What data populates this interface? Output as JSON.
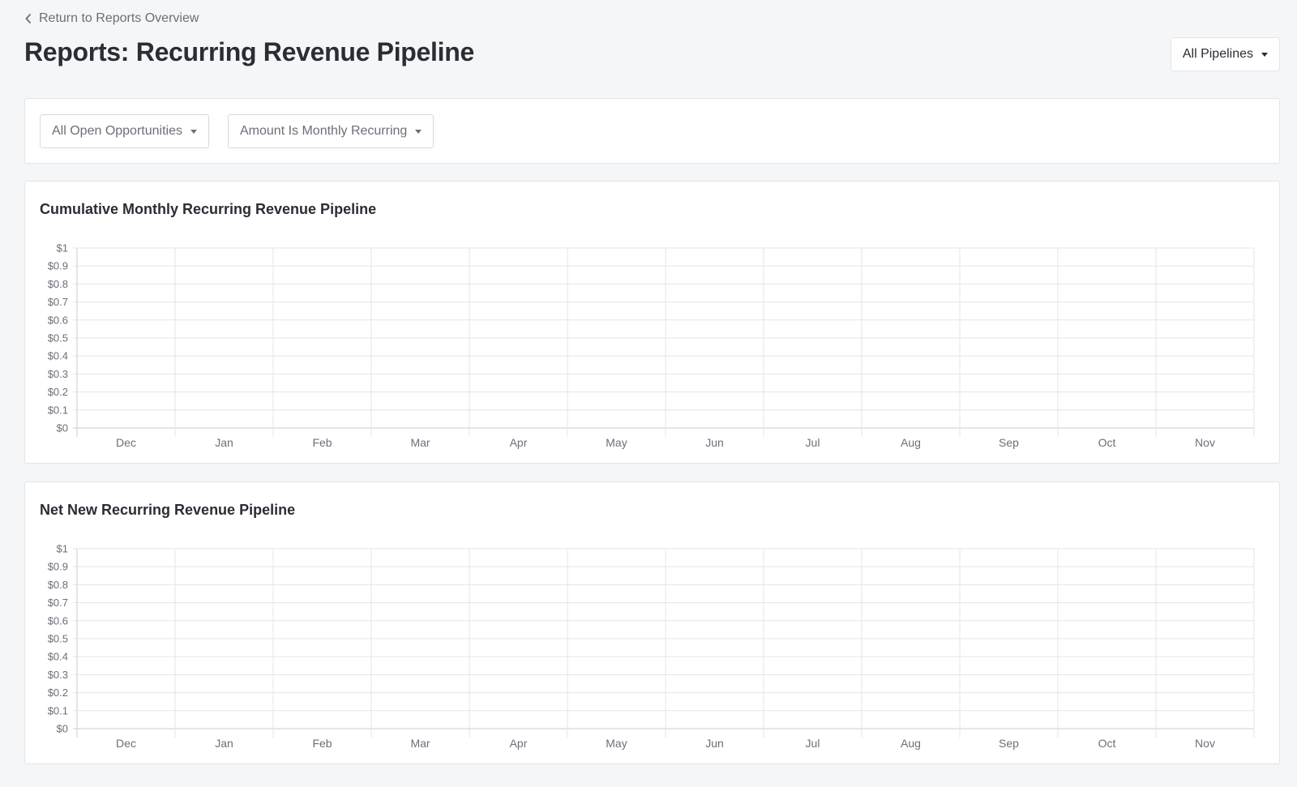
{
  "nav": {
    "back_label": "Return to Reports Overview"
  },
  "header": {
    "title": "Reports: Recurring Revenue Pipeline",
    "pipeline_select": "All Pipelines"
  },
  "filters": {
    "opportunities": "All Open Opportunities",
    "amount_type": "Amount Is Monthly Recurring"
  },
  "colors": {
    "background": "#f5f6f8",
    "grid": "#e3e5e8",
    "axis": "#c9ccd1",
    "text_muted": "#6b6f78"
  },
  "chart_data": [
    {
      "type": "line",
      "title": "Cumulative Monthly Recurring Revenue Pipeline",
      "categories": [
        "Dec",
        "Jan",
        "Feb",
        "Mar",
        "Apr",
        "May",
        "Jun",
        "Jul",
        "Aug",
        "Sep",
        "Oct",
        "Nov"
      ],
      "y_ticks": [
        "$0",
        "$0.1",
        "$0.2",
        "$0.3",
        "$0.4",
        "$0.5",
        "$0.6",
        "$0.7",
        "$0.8",
        "$0.9",
        "$1"
      ],
      "ylim": [
        0,
        1
      ],
      "series": [],
      "grid": true
    },
    {
      "type": "line",
      "title": "Net New Recurring Revenue Pipeline",
      "categories": [
        "Dec",
        "Jan",
        "Feb",
        "Mar",
        "Apr",
        "May",
        "Jun",
        "Jul",
        "Aug",
        "Sep",
        "Oct",
        "Nov"
      ],
      "y_ticks": [
        "$0",
        "$0.1",
        "$0.2",
        "$0.3",
        "$0.4",
        "$0.5",
        "$0.6",
        "$0.7",
        "$0.8",
        "$0.9",
        "$1"
      ],
      "ylim": [
        0,
        1
      ],
      "series": [],
      "grid": true
    }
  ]
}
